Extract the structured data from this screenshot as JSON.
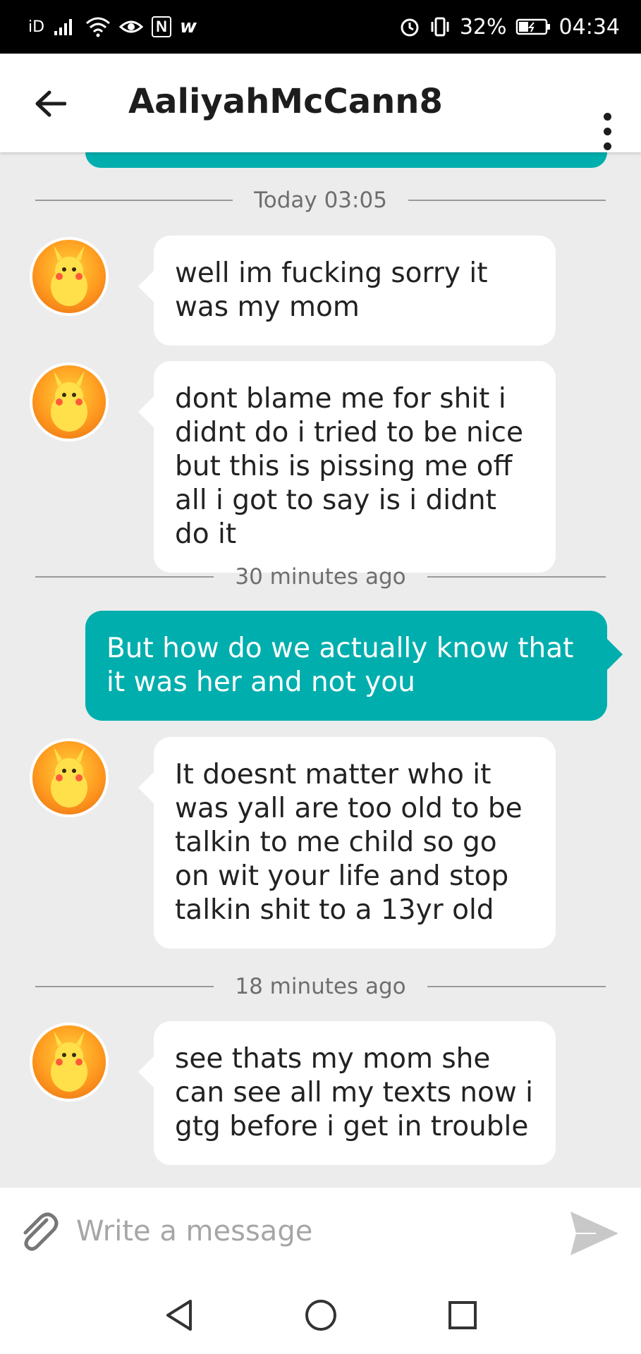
{
  "status_bar": {
    "carrier": "iD",
    "nfc_label": "N",
    "app_badge": "w",
    "battery_percent": "32%",
    "time": "04:34"
  },
  "header": {
    "title": "AaliyahMcCann8"
  },
  "conversation": {
    "separator_1": "Today 03:05",
    "message_1": "well im fucking sorry it was my mom",
    "message_2": "dont blame me for shit i didnt do i tried to be nice but this is pissing me off all i got to say is i didnt do it",
    "separator_2": "30 minutes ago",
    "message_3": "But how do we actually know that it was her and not you",
    "message_4": "It doesnt matter who it was yall are too old to be talkin to me child so go on wit your life and stop talkin shit to a 13yr old",
    "separator_3": "18 minutes ago",
    "message_5": "see thats my mom she can see all my texts now i gtg before i get in trouble"
  },
  "composer": {
    "placeholder": "Write a message"
  },
  "colors": {
    "accent": "#00aeae",
    "background": "#ececec",
    "bubble_in": "#ffffff"
  },
  "icons": {
    "back": "arrow-left-icon",
    "more": "more-vertical-icon",
    "attach": "paperclip-icon",
    "send": "send-icon",
    "nav_back": "triangle-back-icon",
    "nav_home": "circle-home-icon",
    "nav_recent": "square-recent-icon"
  }
}
